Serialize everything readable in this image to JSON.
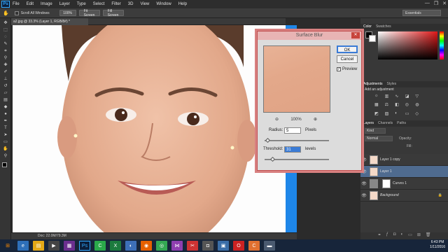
{
  "app": {
    "logo": "Ps"
  },
  "menu": [
    "File",
    "Edit",
    "Image",
    "Layer",
    "Type",
    "Select",
    "Filter",
    "3D",
    "View",
    "Window",
    "Help"
  ],
  "options": {
    "scroll_all": "Scroll All Windows",
    "btn1": "100%",
    "btn2": "Fit Screen",
    "btn3": "Fill Screen",
    "workspace": "Essentials"
  },
  "document": {
    "tab": "a2.jpg @ 33.3% (Layer 1, RGB/8#) *",
    "status": "Doc: 22.0M/79.3M"
  },
  "dialog": {
    "title": "Surface Blur",
    "ok": "OK",
    "cancel": "Cancel",
    "preview_label": "Preview",
    "zoom": "100%",
    "radius_label": "Radius:",
    "radius_value": "5",
    "radius_unit": "Pixels",
    "threshold_label": "Threshold:",
    "threshold_value": "31",
    "threshold_unit": "levels"
  },
  "panels": {
    "color_tabs": [
      "Color",
      "Swatches"
    ],
    "adj_tabs": [
      "Adjustments",
      "Styles"
    ],
    "adj_title": "Add an adjustment",
    "layer_tabs": [
      "Layers",
      "Channels",
      "Paths"
    ],
    "kind": "Kind",
    "blend": "Normal",
    "opacity_label": "Opacity:",
    "fill_label": "Fill:",
    "layers": [
      "Layer 1 copy",
      "Layer 1",
      "Curves 1",
      "Background"
    ]
  },
  "colors": {
    "accent_blue": "#1e86e8",
    "dialog_border": "#c05050",
    "selected_layer": "#4f6b8f"
  },
  "taskbar": {
    "time": "6:43 PM",
    "date": "1/11/2016"
  }
}
